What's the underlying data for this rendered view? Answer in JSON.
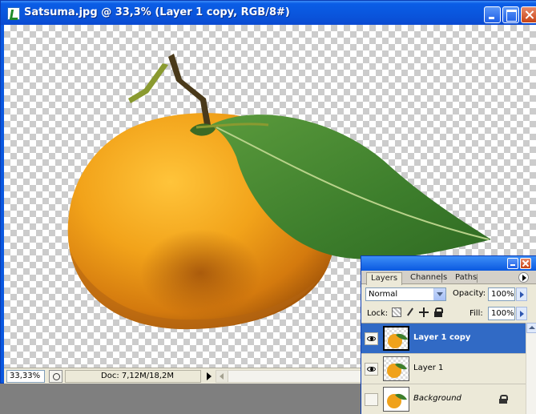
{
  "window": {
    "title": "Satsuma.jpg @ 33,3% (Layer 1 copy, RGB/8#)",
    "icon": "photoshop-document-icon",
    "controls": [
      "minimize",
      "maximize",
      "close"
    ]
  },
  "statusbar": {
    "zoom": "33,33%",
    "doc_info": "Doc: 7,12M/18,2M"
  },
  "layers_panel": {
    "tabs": [
      {
        "label": "Layers",
        "active": true
      },
      {
        "label": "Channels",
        "active": false
      },
      {
        "label": "Paths",
        "active": false
      }
    ],
    "blend_mode": "Normal",
    "opacity_label": "Opacity:",
    "opacity_value": "100%",
    "lock_label": "Lock:",
    "fill_label": "Fill:",
    "fill_value": "100%",
    "layers": [
      {
        "name": "Layer 1 copy",
        "visible": true,
        "selected": true
      },
      {
        "name": "Layer 1",
        "visible": true,
        "selected": false
      },
      {
        "name": "Background",
        "visible": false,
        "selected": false,
        "locked": true,
        "italic": true
      }
    ]
  },
  "colors": {
    "titlebar": "#0a58e0",
    "selection": "#316ac5",
    "panel_bg": "#ece9d8"
  }
}
